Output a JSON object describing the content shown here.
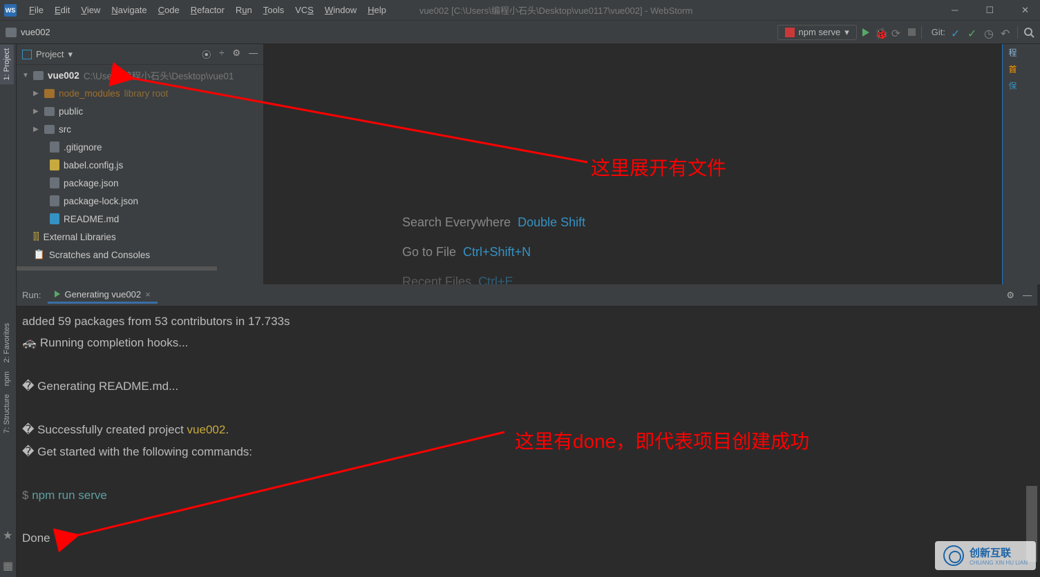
{
  "title_suffix": "vue002 [C:\\Users\\编程小石头\\Desktop\\vue0117\\vue002] - WebStorm",
  "menus": [
    "File",
    "Edit",
    "View",
    "Navigate",
    "Code",
    "Refactor",
    "Run",
    "Tools",
    "VCS",
    "Window",
    "Help"
  ],
  "breadcrumb": "vue002",
  "run_config": "npm serve",
  "git_label": "Git:",
  "left_tabs": {
    "project": "1: Project",
    "favorites": "2: Favorites",
    "npm": "npm",
    "structure": "7: Structure"
  },
  "project_header": "Project",
  "tree": {
    "root_name": "vue002",
    "root_path": "C:\\Users\\编程小石头\\Desktop\\vue01",
    "node_modules": "node_modules",
    "node_modules_tag": "library root",
    "public": "public",
    "src": "src",
    "gitignore": ".gitignore",
    "babel": "babel.config.js",
    "package": "package.json",
    "packagelock": "package-lock.json",
    "readme": "README.md",
    "external": "External Libraries",
    "scratches": "Scratches and Consoles"
  },
  "tips": [
    {
      "label": "Search Everywhere",
      "key": "Double Shift"
    },
    {
      "label": "Go to File",
      "key": "Ctrl+Shift+N"
    },
    {
      "label": "Recent Files",
      "key": "Ctrl+E"
    }
  ],
  "run_panel": {
    "label": "Run:",
    "tab": "Generating vue002"
  },
  "console": {
    "l1": "added 59 packages from 53 contributors in 17.733s",
    "l2": "🚓  Running completion hooks...",
    "l3": "�  Generating README.md...",
    "l4a": "�  Successfully created project ",
    "l4b": "vue002",
    "l4c": ".",
    "l5": "�  Get started with the following commands:",
    "l6_prompt": " $ ",
    "l6_cmd": "npm run serve",
    "done": "Done"
  },
  "annotations": {
    "top": "这里展开有文件",
    "bottom": "这里有done，即代表项目创建成功"
  },
  "watermark": {
    "brand": "创新互联",
    "sub": "CHUANG XIN HU LIAN"
  }
}
